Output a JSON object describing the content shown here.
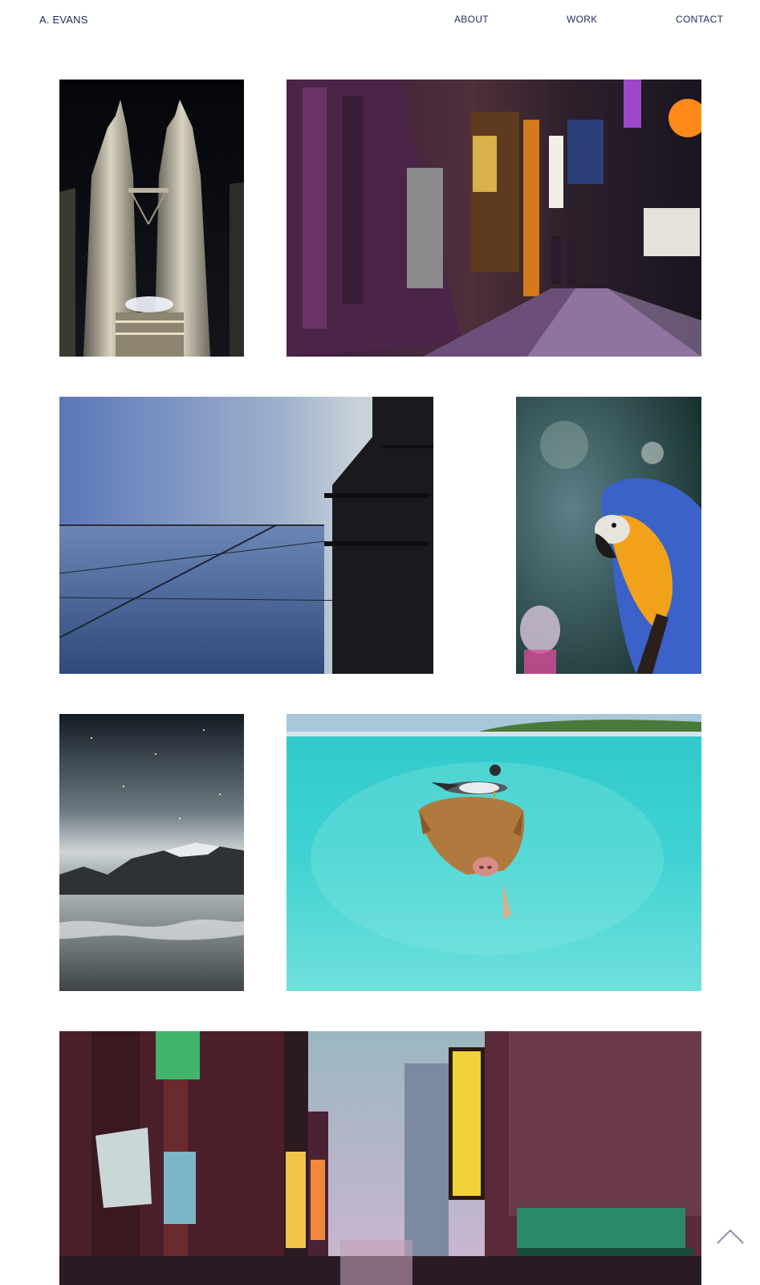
{
  "header": {
    "brand": "A. EVANS",
    "nav": {
      "about": "ABOUT",
      "work": "WORK",
      "contact": "CONTACT"
    }
  },
  "gallery": {
    "photos": [
      {
        "subject": "twin towers at night"
      },
      {
        "subject": "neon city alley at night"
      },
      {
        "subject": "glass building and sky"
      },
      {
        "subject": "blue and yellow macaw"
      },
      {
        "subject": "mountains under starry sky with misty water"
      },
      {
        "subject": "swimming pig with seagull in turquoise water"
      },
      {
        "subject": "neon street with dvd shop signs"
      }
    ]
  },
  "scroll_top": {
    "icon": "chevron-up-icon"
  },
  "colors": {
    "nav_text": "#1f2a5a",
    "background": "#ffffff",
    "scroll_icon": "#8b91a8"
  }
}
